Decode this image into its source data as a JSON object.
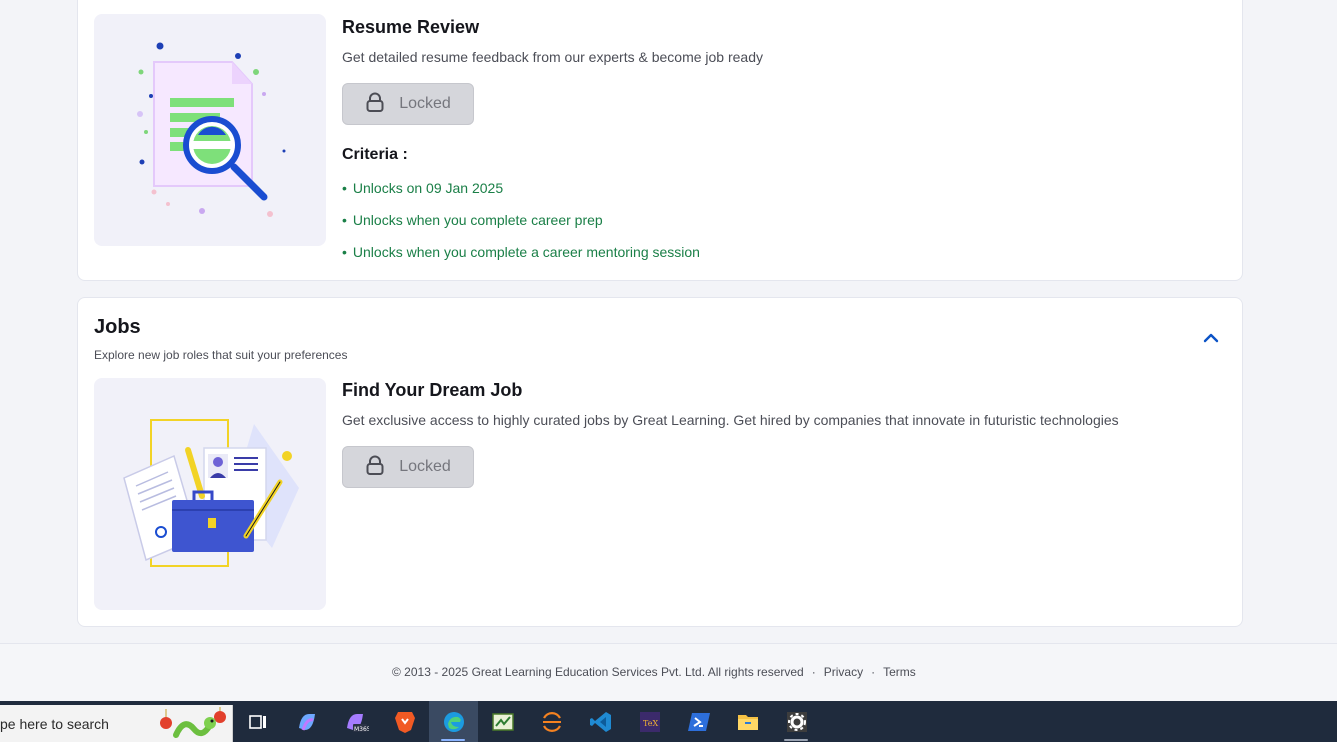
{
  "resume_card": {
    "title": "Resume Review",
    "description": "Get detailed resume feedback from our experts & become job ready",
    "locked_label": "Locked",
    "criteria_label": "Criteria :",
    "criteria": [
      "Unlocks on 09 Jan 2025",
      "Unlocks when you complete career prep",
      "Unlocks when you complete a career mentoring session"
    ],
    "illustration_icon": "resume-magnifier-illustration"
  },
  "jobs_section": {
    "title": "Jobs",
    "subtitle": "Explore new job roles that suit your preferences",
    "collapse_icon": "chevron-up-icon",
    "card": {
      "title": "Find Your Dream Job",
      "description": "Get exclusive access to highly curated jobs by Great Learning. Get hired by companies that innovate in futuristic technologies",
      "locked_label": "Locked",
      "illustration_icon": "briefcase-resume-illustration"
    }
  },
  "footer": {
    "copyright": "© 2013 - 2025 Great Learning Education Services Pvt. Ltd. All rights reserved",
    "sep": "·",
    "links": [
      "Privacy",
      "Terms"
    ]
  },
  "taskbar": {
    "search_placeholder": "pe here to search",
    "apps": [
      "task-view-icon",
      "copilot-icon",
      "m365-copilot-icon",
      "brave-icon",
      "edge-icon",
      "cmd-app-icon",
      "eclipse-icon",
      "vscode-icon",
      "tex-icon",
      "powershell-icon",
      "file-explorer-icon",
      "settings-icon"
    ],
    "active_app": "edge-icon"
  },
  "colors": {
    "accent_blue": "#0b53c6",
    "criteria_green": "#1a7f47",
    "locked_bg": "#d5d6db"
  }
}
